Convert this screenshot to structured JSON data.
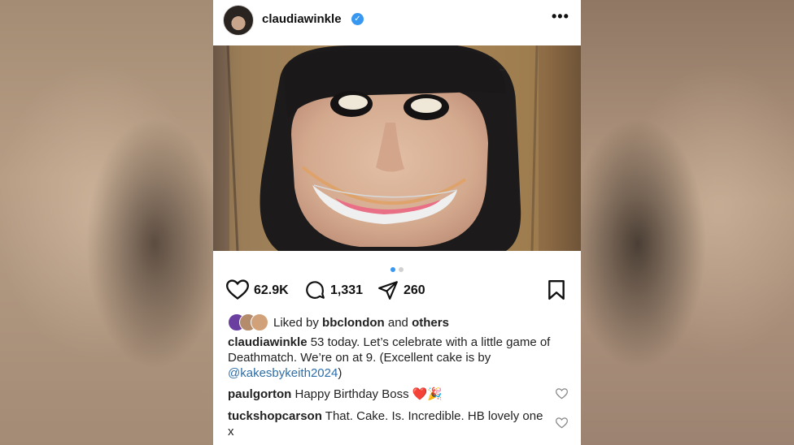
{
  "post": {
    "username": "claudiawinkle",
    "verified": true,
    "likes_count": "62.9K",
    "comments_count": "1,331",
    "shares_count": "260",
    "carousel": {
      "total": 2,
      "active": 1
    },
    "liked_by": {
      "prefix": "Liked by",
      "user": "bbclondon",
      "joiner": "and",
      "others": "others"
    },
    "caption": {
      "user": "claudiawinkle",
      "text": "53 today. Let’s celebrate with a little game of Deathmatch. We’re on at 9. (Excellent cake is by",
      "mention": "@kakesbykeith2024",
      "suffix": ")"
    },
    "comments": [
      {
        "user": "paulgorton",
        "text": "Happy Birthday Boss ❤️🎉"
      },
      {
        "user": "tuckshopcarson",
        "text": "That. Cake. Is. Incredible. HB lovely one x"
      }
    ]
  },
  "icons": {
    "like": "heart-icon",
    "comment": "comment-icon",
    "share": "send-icon",
    "save": "bookmark-icon",
    "more": "more-icon",
    "verified": "verified-badge-icon"
  },
  "colors": {
    "accent": "#3897f0",
    "mention": "#2e6ea8",
    "text": "#222222"
  }
}
